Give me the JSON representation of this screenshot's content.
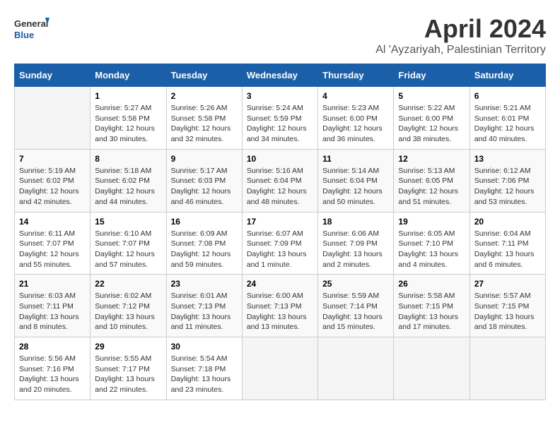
{
  "logo": {
    "line1": "General",
    "line2": "Blue"
  },
  "title": "April 2024",
  "subtitle": "Al 'Ayzariyah, Palestinian Territory",
  "headers": [
    "Sunday",
    "Monday",
    "Tuesday",
    "Wednesday",
    "Thursday",
    "Friday",
    "Saturday"
  ],
  "weeks": [
    [
      {
        "day": "",
        "content": ""
      },
      {
        "day": "1",
        "content": "Sunrise: 5:27 AM\nSunset: 5:58 PM\nDaylight: 12 hours\nand 30 minutes."
      },
      {
        "day": "2",
        "content": "Sunrise: 5:26 AM\nSunset: 5:58 PM\nDaylight: 12 hours\nand 32 minutes."
      },
      {
        "day": "3",
        "content": "Sunrise: 5:24 AM\nSunset: 5:59 PM\nDaylight: 12 hours\nand 34 minutes."
      },
      {
        "day": "4",
        "content": "Sunrise: 5:23 AM\nSunset: 6:00 PM\nDaylight: 12 hours\nand 36 minutes."
      },
      {
        "day": "5",
        "content": "Sunrise: 5:22 AM\nSunset: 6:00 PM\nDaylight: 12 hours\nand 38 minutes."
      },
      {
        "day": "6",
        "content": "Sunrise: 5:21 AM\nSunset: 6:01 PM\nDaylight: 12 hours\nand 40 minutes."
      }
    ],
    [
      {
        "day": "7",
        "content": "Sunrise: 5:19 AM\nSunset: 6:02 PM\nDaylight: 12 hours\nand 42 minutes."
      },
      {
        "day": "8",
        "content": "Sunrise: 5:18 AM\nSunset: 6:02 PM\nDaylight: 12 hours\nand 44 minutes."
      },
      {
        "day": "9",
        "content": "Sunrise: 5:17 AM\nSunset: 6:03 PM\nDaylight: 12 hours\nand 46 minutes."
      },
      {
        "day": "10",
        "content": "Sunrise: 5:16 AM\nSunset: 6:04 PM\nDaylight: 12 hours\nand 48 minutes."
      },
      {
        "day": "11",
        "content": "Sunrise: 5:14 AM\nSunset: 6:04 PM\nDaylight: 12 hours\nand 50 minutes."
      },
      {
        "day": "12",
        "content": "Sunrise: 5:13 AM\nSunset: 6:05 PM\nDaylight: 12 hours\nand 51 minutes."
      },
      {
        "day": "13",
        "content": "Sunrise: 6:12 AM\nSunset: 7:06 PM\nDaylight: 12 hours\nand 53 minutes."
      }
    ],
    [
      {
        "day": "14",
        "content": "Sunrise: 6:11 AM\nSunset: 7:07 PM\nDaylight: 12 hours\nand 55 minutes."
      },
      {
        "day": "15",
        "content": "Sunrise: 6:10 AM\nSunset: 7:07 PM\nDaylight: 12 hours\nand 57 minutes."
      },
      {
        "day": "16",
        "content": "Sunrise: 6:09 AM\nSunset: 7:08 PM\nDaylight: 12 hours\nand 59 minutes."
      },
      {
        "day": "17",
        "content": "Sunrise: 6:07 AM\nSunset: 7:09 PM\nDaylight: 13 hours\nand 1 minute."
      },
      {
        "day": "18",
        "content": "Sunrise: 6:06 AM\nSunset: 7:09 PM\nDaylight: 13 hours\nand 2 minutes."
      },
      {
        "day": "19",
        "content": "Sunrise: 6:05 AM\nSunset: 7:10 PM\nDaylight: 13 hours\nand 4 minutes."
      },
      {
        "day": "20",
        "content": "Sunrise: 6:04 AM\nSunset: 7:11 PM\nDaylight: 13 hours\nand 6 minutes."
      }
    ],
    [
      {
        "day": "21",
        "content": "Sunrise: 6:03 AM\nSunset: 7:11 PM\nDaylight: 13 hours\nand 8 minutes."
      },
      {
        "day": "22",
        "content": "Sunrise: 6:02 AM\nSunset: 7:12 PM\nDaylight: 13 hours\nand 10 minutes."
      },
      {
        "day": "23",
        "content": "Sunrise: 6:01 AM\nSunset: 7:13 PM\nDaylight: 13 hours\nand 11 minutes."
      },
      {
        "day": "24",
        "content": "Sunrise: 6:00 AM\nSunset: 7:13 PM\nDaylight: 13 hours\nand 13 minutes."
      },
      {
        "day": "25",
        "content": "Sunrise: 5:59 AM\nSunset: 7:14 PM\nDaylight: 13 hours\nand 15 minutes."
      },
      {
        "day": "26",
        "content": "Sunrise: 5:58 AM\nSunset: 7:15 PM\nDaylight: 13 hours\nand 17 minutes."
      },
      {
        "day": "27",
        "content": "Sunrise: 5:57 AM\nSunset: 7:15 PM\nDaylight: 13 hours\nand 18 minutes."
      }
    ],
    [
      {
        "day": "28",
        "content": "Sunrise: 5:56 AM\nSunset: 7:16 PM\nDaylight: 13 hours\nand 20 minutes."
      },
      {
        "day": "29",
        "content": "Sunrise: 5:55 AM\nSunset: 7:17 PM\nDaylight: 13 hours\nand 22 minutes."
      },
      {
        "day": "30",
        "content": "Sunrise: 5:54 AM\nSunset: 7:18 PM\nDaylight: 13 hours\nand 23 minutes."
      },
      {
        "day": "",
        "content": ""
      },
      {
        "day": "",
        "content": ""
      },
      {
        "day": "",
        "content": ""
      },
      {
        "day": "",
        "content": ""
      }
    ]
  ]
}
